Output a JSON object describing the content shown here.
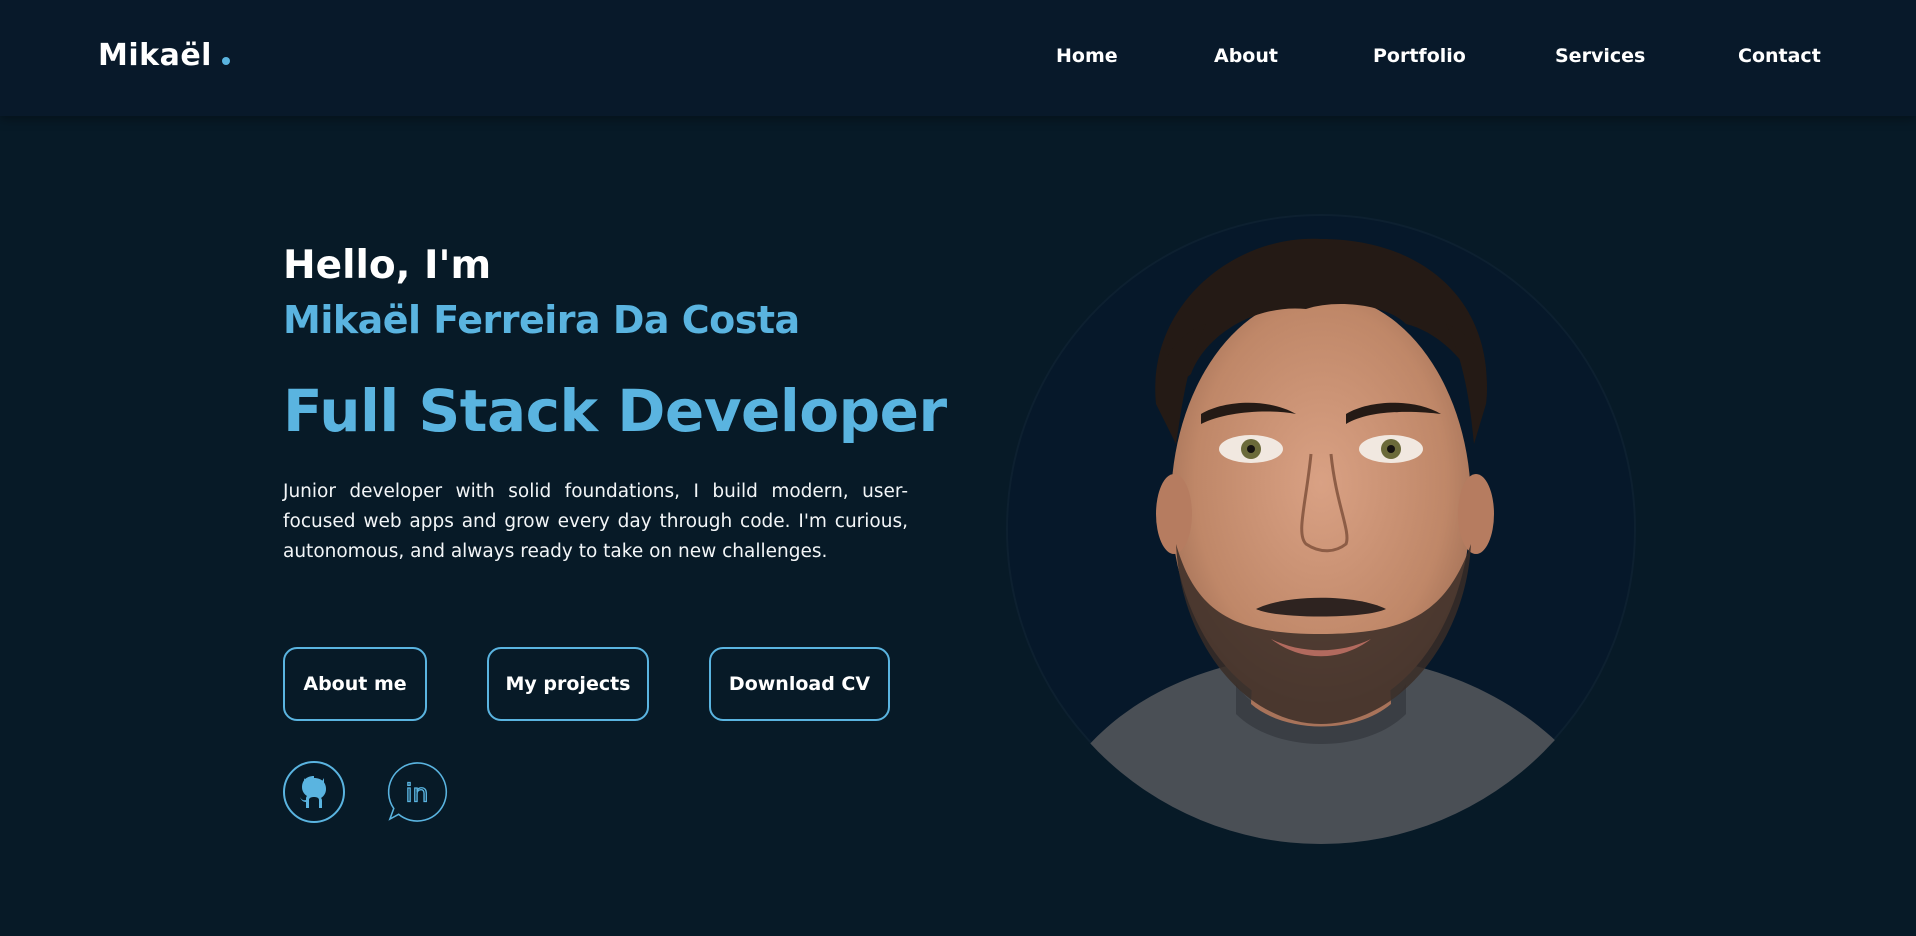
{
  "brand": {
    "name": "Mikaël",
    "accent_color": "#5ab4e0"
  },
  "nav": {
    "items": [
      {
        "label": "Home"
      },
      {
        "label": "About"
      },
      {
        "label": "Portfolio"
      },
      {
        "label": "Services"
      },
      {
        "label": "Contact"
      }
    ]
  },
  "hero": {
    "greeting": "Hello, I'm",
    "name": "Mikaël Ferreira Da Costa",
    "role": "Full Stack Developer",
    "description": "Junior developer with solid foundations, I build modern, user-focused web apps and grow every day through code. I'm curious, autonomous, and always ready to take on new challenges.",
    "buttons": {
      "about": "About me",
      "projects": "My projects",
      "cv": "Download CV"
    },
    "socials": [
      {
        "icon": "github-icon"
      },
      {
        "icon": "linkedin-icon"
      }
    ],
    "portrait": {
      "icon": "profile-photo"
    }
  },
  "colors": {
    "background": "#071a27",
    "navbar": "#08192a",
    "accent": "#5ab4e0",
    "text": "#ffffff"
  }
}
